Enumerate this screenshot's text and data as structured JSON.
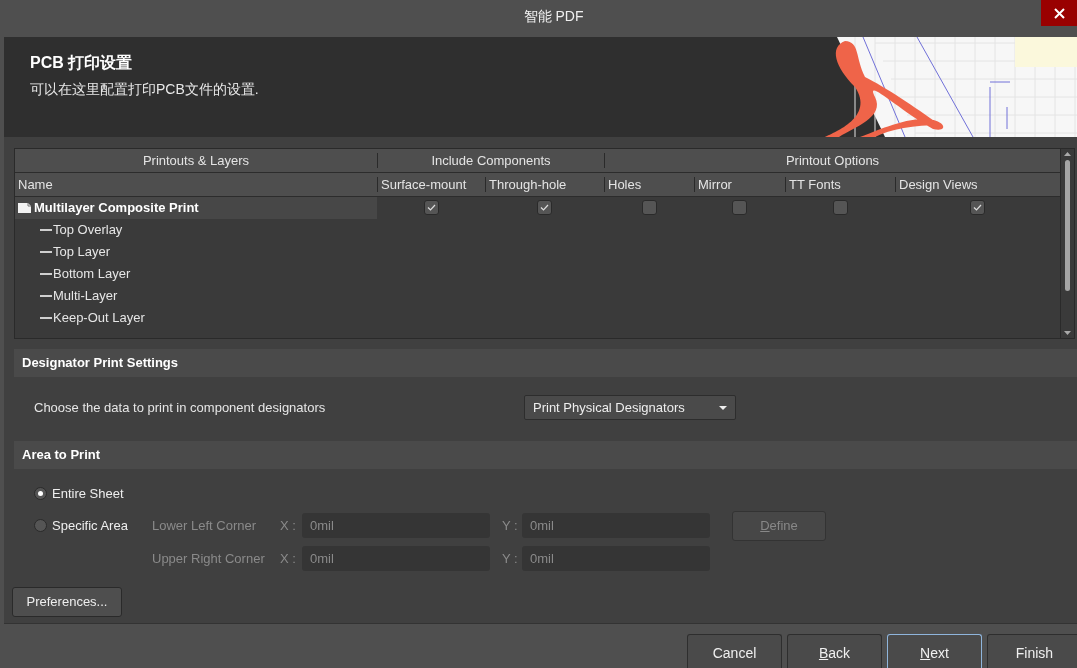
{
  "window": {
    "title": "智能 PDF"
  },
  "header": {
    "title": "PCB 打印设置",
    "subtitle": "可以在这里配置打印PCB文件的设置."
  },
  "layers_table": {
    "column_groups": [
      "Printouts & Layers",
      "Include Components",
      "Printout Options"
    ],
    "columns": [
      "Name",
      "Surface-mount",
      "Through-hole",
      "Holes",
      "Mirror",
      "TT Fonts",
      "Design Views"
    ],
    "rows": [
      {
        "name": "Multilayer Composite Print",
        "selected": true,
        "checks": [
          true,
          true,
          false,
          false,
          false,
          true
        ],
        "children": [
          {
            "name": "Top Overlay"
          },
          {
            "name": "Top Layer"
          },
          {
            "name": "Bottom Layer"
          },
          {
            "name": "Multi-Layer"
          },
          {
            "name": "Keep-Out Layer"
          }
        ]
      }
    ]
  },
  "designator": {
    "title": "Designator Print Settings",
    "label": "Choose the data to print in component designators",
    "dropdown": "Print Physical Designators"
  },
  "area": {
    "title": "Area to Print",
    "options": [
      {
        "label": "Entire Sheet",
        "selected": true
      },
      {
        "label": "Specific Area",
        "selected": false
      }
    ],
    "fields": [
      {
        "label": "Lower Left Corner",
        "x_label": "X :",
        "x": "0mil",
        "y_label": "Y :",
        "y": "0mil"
      },
      {
        "label": "Upper Right Corner",
        "x_label": "X :",
        "x": "0mil",
        "y_label": "Y :",
        "y": "0mil"
      }
    ],
    "define_button": {
      "label": "Define",
      "underline_first": true,
      "disabled": true
    }
  },
  "preferences_button": "Preferences...",
  "buttons": [
    {
      "label": "Cancel",
      "focused": false
    },
    {
      "label": "Back",
      "underline_first": true,
      "focused": false
    },
    {
      "label": "Next",
      "underline_first": true,
      "focused": true
    },
    {
      "label": "Finish",
      "focused": false
    }
  ]
}
